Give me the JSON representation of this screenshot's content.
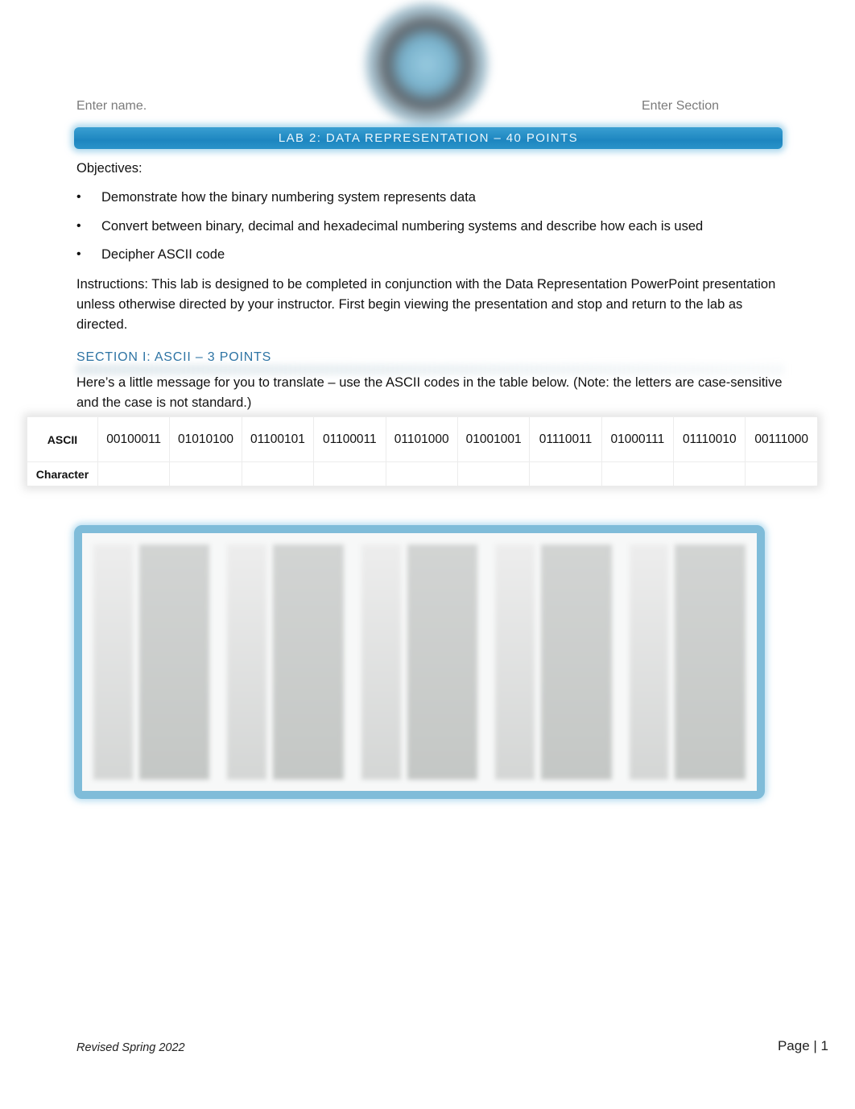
{
  "header": {
    "logo": "college-seal-logo",
    "name_placeholder": "Enter name.",
    "section_placeholder": "Enter Section",
    "title": "LAB 2: DATA REPRESENTATION – 40 POINTS"
  },
  "objectives": {
    "heading": "Objectives:",
    "items": [
      "Demonstrate how the binary numbering system represents data",
      "Convert between binary, decimal and hexadecimal numbering systems and describe how each is used",
      "Decipher ASCII code"
    ]
  },
  "instructions": "Instructions: This lab is designed to be completed in conjunction with the Data Representation PowerPoint presentation unless otherwise directed by your instructor. First begin viewing the presentation and stop and return to the lab as directed.",
  "section1": {
    "heading": "SECTION I: ASCII – 3 POINTS",
    "prompt": "Here’s a little message for you to translate – use the ASCII codes in the table below. (Note: the letters are case-sensitive and the case is not standard.)",
    "table": {
      "row_labels": [
        "ASCII",
        "Character"
      ],
      "codes": [
        "00100011",
        "01010100",
        "01100101",
        "01100011",
        "01101000",
        "01001001",
        "01110011",
        "01000111",
        "01110010",
        "00111000"
      ],
      "characters": [
        "",
        "",
        "",
        "",
        "",
        "",
        "",
        "",
        "",
        ""
      ]
    },
    "reference_image": "ascii-code-reference-table (blurred)"
  },
  "footer": {
    "revised": "Revised Spring 2022",
    "page": "Page | 1"
  }
}
